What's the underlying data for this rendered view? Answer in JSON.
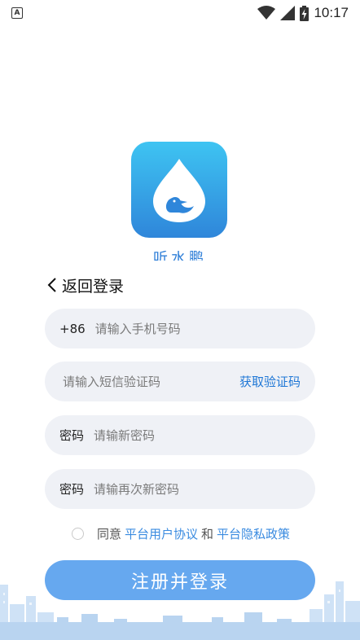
{
  "status_bar": {
    "notification_letter": "A",
    "time": "10:17"
  },
  "app": {
    "name": "听水鹏"
  },
  "nav": {
    "back_label": "返回登录"
  },
  "form": {
    "phone_prefix": "+86",
    "phone_placeholder": "请输入手机号码",
    "code_placeholder": "请输入短信验证码",
    "get_code_label": "获取验证码",
    "password_label": "密码",
    "password_placeholder": "请输新密码",
    "confirm_label": "密码",
    "confirm_placeholder": "请输再次新密码"
  },
  "agreement": {
    "prefix": "同意",
    "user_agreement": "平台用户协议",
    "conjunction": "和",
    "privacy_policy": "平台隐私政策"
  },
  "submit_label": "注册并登录",
  "colors": {
    "accent": "#1f77d6",
    "button": "#66a8ef",
    "field_bg": "#eff1f6"
  }
}
